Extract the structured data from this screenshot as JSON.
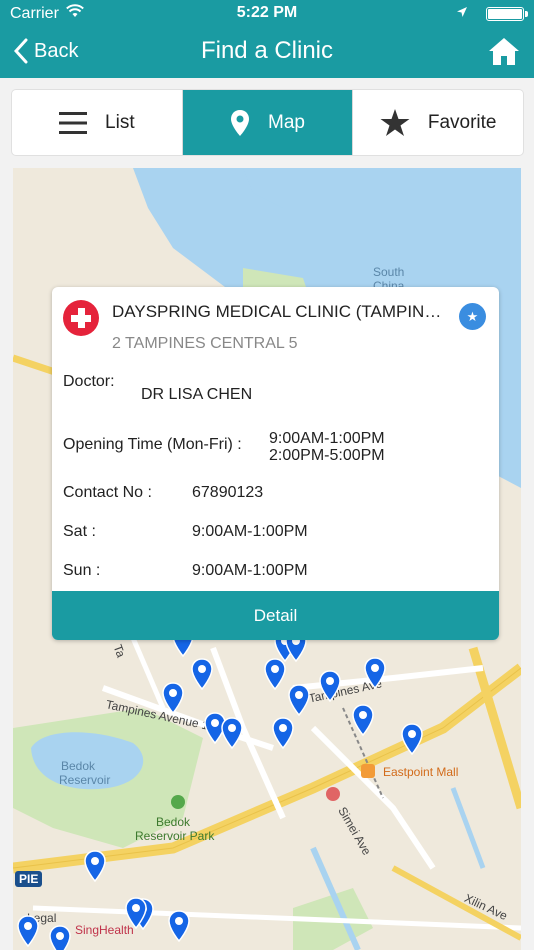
{
  "status_bar": {
    "carrier": "Carrier",
    "time": "5:22 PM"
  },
  "nav": {
    "back_label": "Back",
    "title": "Find a Clinic"
  },
  "tabs": [
    {
      "label": "List",
      "icon": "list-icon",
      "active": false
    },
    {
      "label": "Map",
      "icon": "map-pin-icon",
      "active": true
    },
    {
      "label": "Favorite",
      "icon": "star-icon",
      "active": false
    }
  ],
  "clinic": {
    "name": "DAYSPRING MEDICAL CLINIC (TAMPINES",
    "address": "2 TAMPINES CENTRAL 5",
    "doctor_label": "Doctor:",
    "doctor": "DR LISA CHEN",
    "opening_label": "Opening Time (Mon-Fri) :",
    "opening_1": "9:00AM-1:00PM",
    "opening_2": "2:00PM-5:00PM",
    "contact_label": "Contact No :",
    "contact": "67890123",
    "sat_label": "Sat :",
    "sat": "9:00AM-1:00PM",
    "sun_label": "Sun :",
    "sun": "9:00AM-1:00PM",
    "detail_label": "Detail"
  },
  "map_labels": {
    "south_china": "South",
    "south_china_2": "China",
    "tampines_ave_1": "Tampines Avenue 1",
    "tampines_ave": "Tampines Ave",
    "bedok_reservoir": "Bedok",
    "bedok_reservoir_2": "Reservoir",
    "bedok_park": "Bedok",
    "bedok_park_2": "Reservoir Park",
    "eastpoint": "Eastpoint Mall",
    "simei": "Simei Ave",
    "xilin": "Xilin Ave",
    "pie": "PIE",
    "legal": "Legal",
    "singhealth": "SingHealth",
    "ta": "Ta"
  },
  "colors": {
    "teal": "#1a9ba2",
    "water": "#a9d3f0",
    "pin": "#1565e6"
  }
}
